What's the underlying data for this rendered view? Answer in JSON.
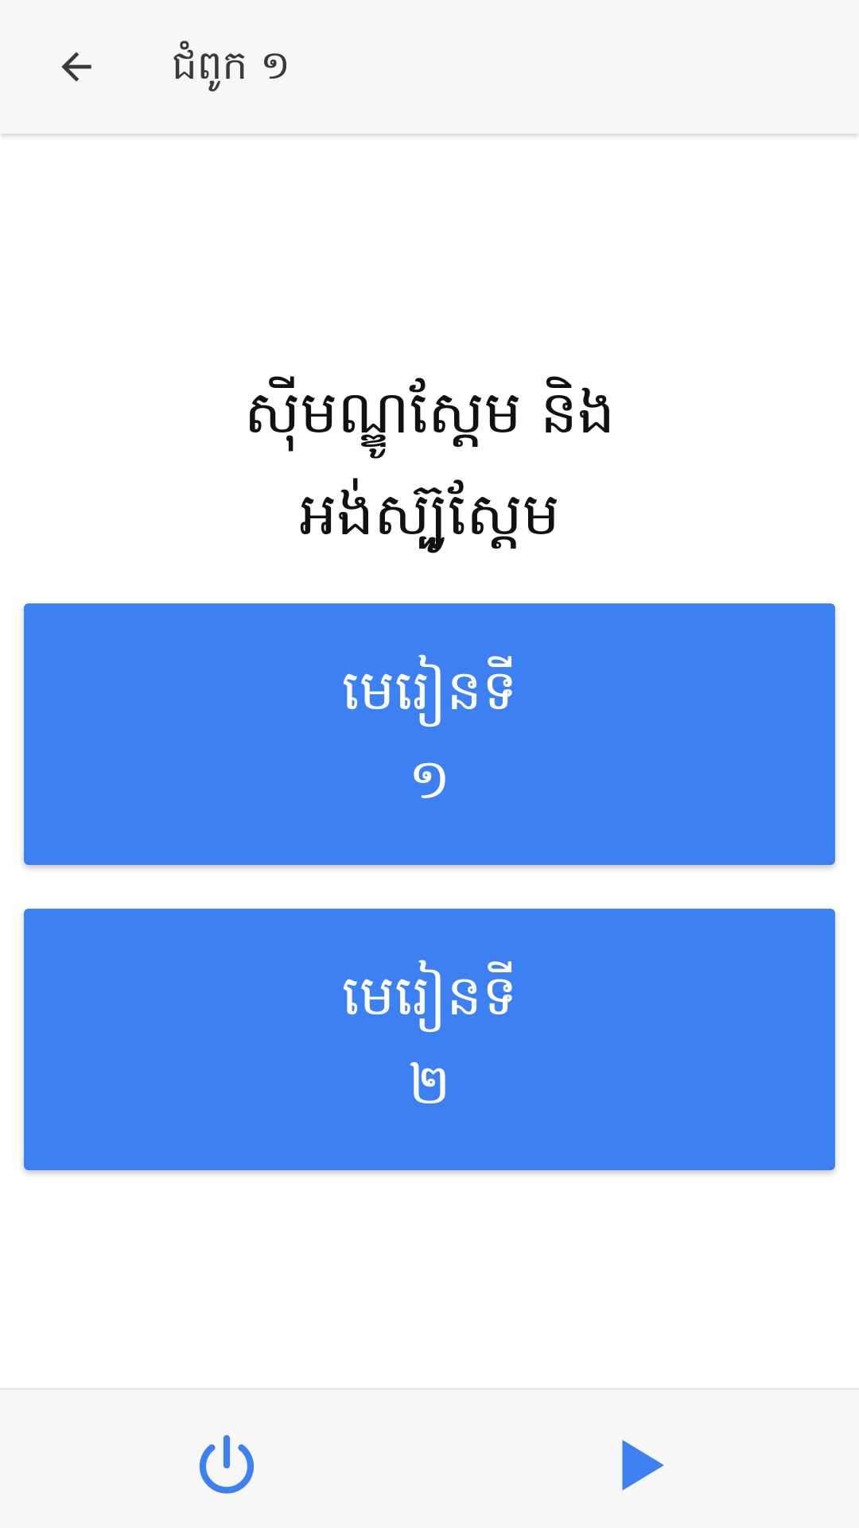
{
  "app_bar": {
    "back_icon": "arrow-back-icon",
    "title": "ជំពូក ១"
  },
  "heading": {
    "line1": "ស៊ីមណ្ឌូស្តែម និង",
    "line2": "អង់ស្ប៊ូស្តែម"
  },
  "lessons": [
    {
      "label_line1": "មេរៀនទី",
      "label_line2": "១"
    },
    {
      "label_line1": "មេរៀនទី",
      "label_line2": "២"
    }
  ],
  "bottom_bar": {
    "power_icon": "power-icon",
    "play_icon": "play-icon"
  },
  "colors": {
    "app_bar_bg": "#f7f7f7",
    "accent": "#3d80f2",
    "button_text": "#ffffff",
    "icon_dark": "#3a3a3a"
  }
}
